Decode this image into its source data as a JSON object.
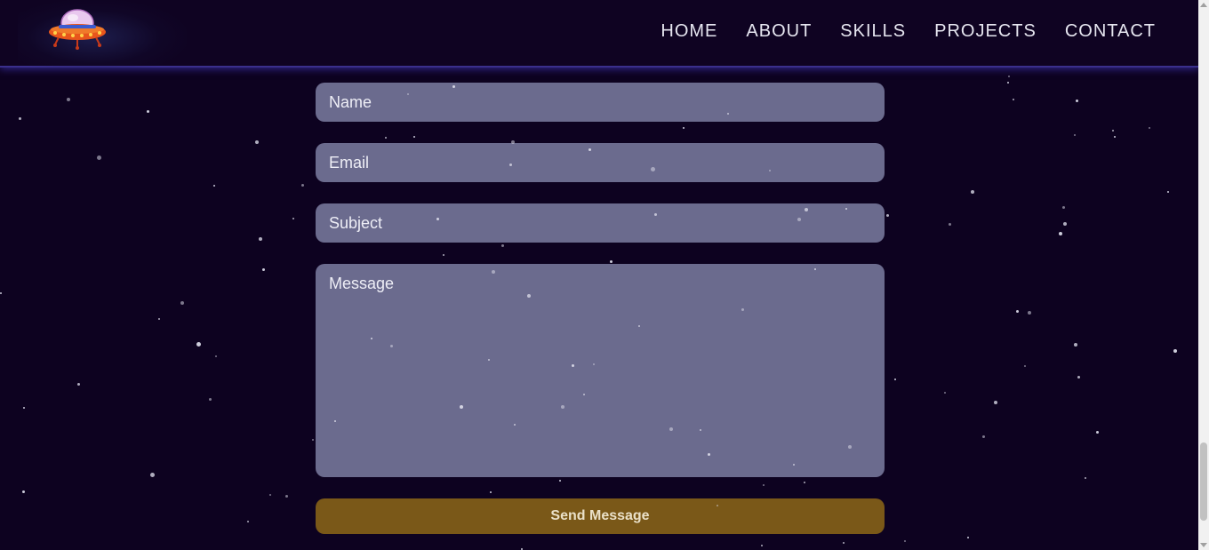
{
  "header": {
    "logo_icon": "ufo-icon",
    "nav": [
      {
        "label": "HOME"
      },
      {
        "label": "ABOUT"
      },
      {
        "label": "SKILLS"
      },
      {
        "label": "PROJECTS"
      },
      {
        "label": "CONTACT"
      }
    ]
  },
  "contact_form": {
    "name_placeholder": "Name",
    "email_placeholder": "Email",
    "subject_placeholder": "Subject",
    "message_placeholder": "Message",
    "send_label": "Send Message"
  },
  "colors": {
    "background": "#0d0220",
    "field": "#6b6b8e",
    "button": "#7a5818",
    "nav_border": "#3a2f8c"
  }
}
